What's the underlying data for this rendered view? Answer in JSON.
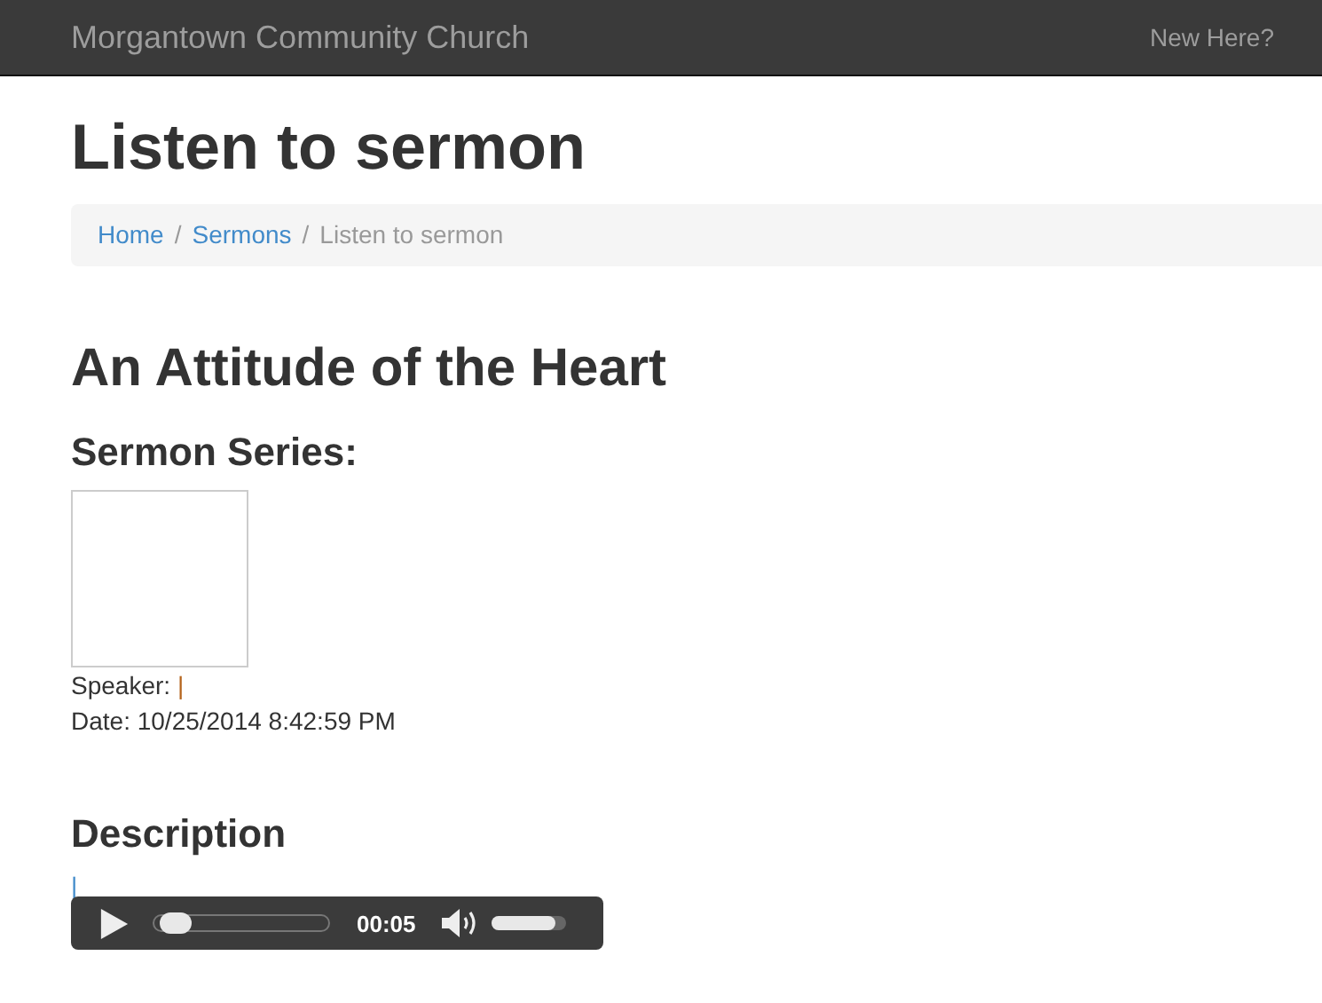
{
  "navbar": {
    "brand": "Morgantown Community Church",
    "link": "New Here?"
  },
  "page_title": "Listen to sermon",
  "breadcrumb": [
    {
      "label": "Home",
      "kind": "link"
    },
    {
      "label": "/",
      "kind": "separator"
    },
    {
      "label": "Sermons",
      "kind": "link"
    },
    {
      "label": "/",
      "kind": "separator"
    },
    {
      "label": "Listen to sermon",
      "kind": "current"
    }
  ],
  "sermon": {
    "title": "An Attitude of the Heart",
    "series_heading": "Sermon Series:",
    "speaker_label": "Speaker:",
    "speaker_value": "|",
    "date": "Date: 10/25/2014 8:42:59 PM",
    "description_heading": "Description",
    "description": "|"
  },
  "player": {
    "playing": false,
    "time": "00:05",
    "progress": {
      "level": 0.05
    },
    "volume": {
      "level": 0.85
    }
  }
}
